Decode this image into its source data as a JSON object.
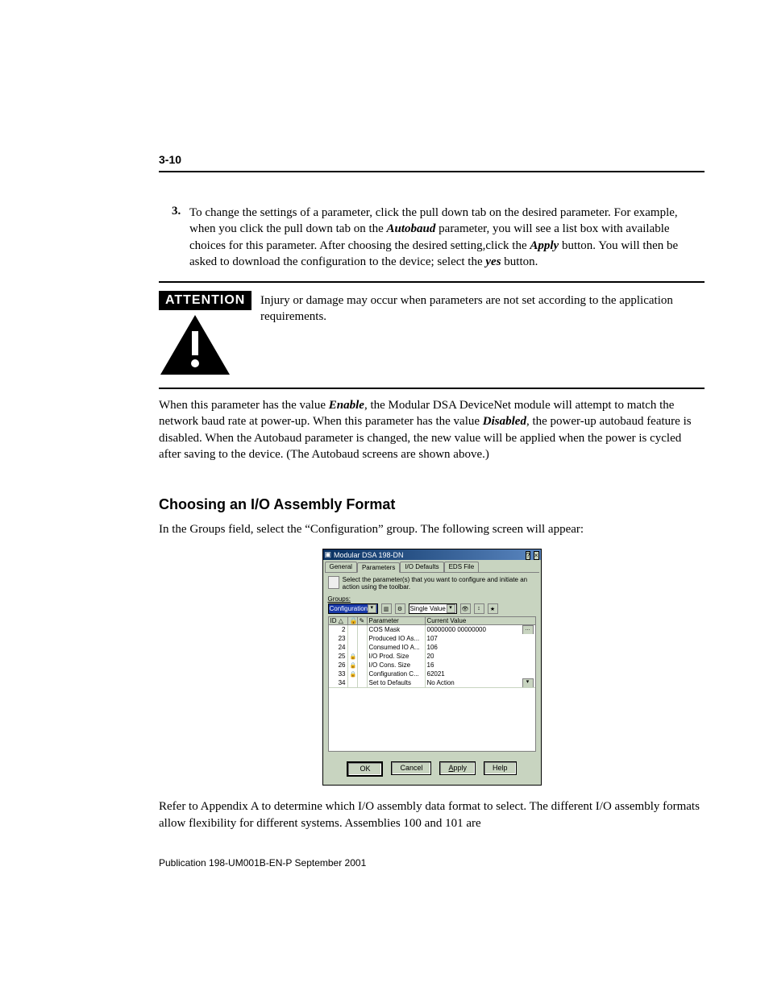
{
  "page_number": "3-10",
  "step": {
    "number": "3.",
    "text_parts": [
      "To change the settings of a parameter, click the pull down tab on the desired parameter. For example, when you click the pull down tab on  the ",
      "Autobaud",
      " parameter, you will see a list box with available choices for this parameter. After choosing the desired setting,click the ",
      "Apply",
      "   button.  You will then be asked to download the configuration to the device; select the ",
      "yes",
      " button."
    ]
  },
  "attention": {
    "label": "ATTENTION",
    "text": "Injury or damage may occur when parameters are not set according to the application requirements."
  },
  "para1_parts": [
    "When this parameter has the value ",
    "Enable",
    ", the Modular DSA DeviceNet module will attempt to match the network baud rate at power-up. When this parameter has the value ",
    "Disabled",
    ", the power-up autobaud feature is disabled. When the Autobaud parameter is changed, the new value will be applied when the power is cycled after saving to the device. (The Autobaud screens are shown above.)"
  ],
  "section_heading": "Choosing an I/O Assembly Format",
  "para2": "In the Groups field, select the “Configuration” group. The following screen will appear:",
  "dialog": {
    "title": "Modular DSA 198-DN",
    "help_btn": "?",
    "close_btn": "×",
    "tabs": [
      "General",
      "Parameters",
      "I/O Defaults",
      "EDS File"
    ],
    "active_tab_index": 1,
    "instruction": "Select the parameter(s) that you want to configure and initiate an action using the toolbar.",
    "groups_label": "Groups:",
    "groups_value": "Configuration",
    "view_value": "Single Value",
    "columns": {
      "id": "ID",
      "a": "",
      "b": "",
      "param": "Parameter",
      "value": "Current Value"
    },
    "rows": [
      {
        "id": "2",
        "lock": false,
        "param": "COS Mask",
        "value": "00000000 00000000",
        "selected": true,
        "dots": true
      },
      {
        "id": "23",
        "lock": false,
        "param": "Produced IO As...",
        "value": "107"
      },
      {
        "id": "24",
        "lock": false,
        "param": "Consumed IO A...",
        "value": "106"
      },
      {
        "id": "25",
        "lock": true,
        "param": "I/O Prod. Size",
        "value": "20"
      },
      {
        "id": "26",
        "lock": true,
        "param": "I/O Cons. Size",
        "value": "16"
      },
      {
        "id": "33",
        "lock": true,
        "param": "Configuration C...",
        "value": "62021"
      },
      {
        "id": "34",
        "lock": false,
        "param": "Set to Defaults",
        "value": "No Action",
        "dropdown": true
      }
    ],
    "buttons": {
      "ok": "OK",
      "cancel": "Cancel",
      "apply": "Apply",
      "help": "Help"
    }
  },
  "para3": "Refer to Appendix A to determine which I/O assembly data format to select. The different I/O assembly formats allow flexibility for different systems. Assemblies 100 and 101 are",
  "publication": "Publication 198-UM001B-EN-P  September 2001"
}
